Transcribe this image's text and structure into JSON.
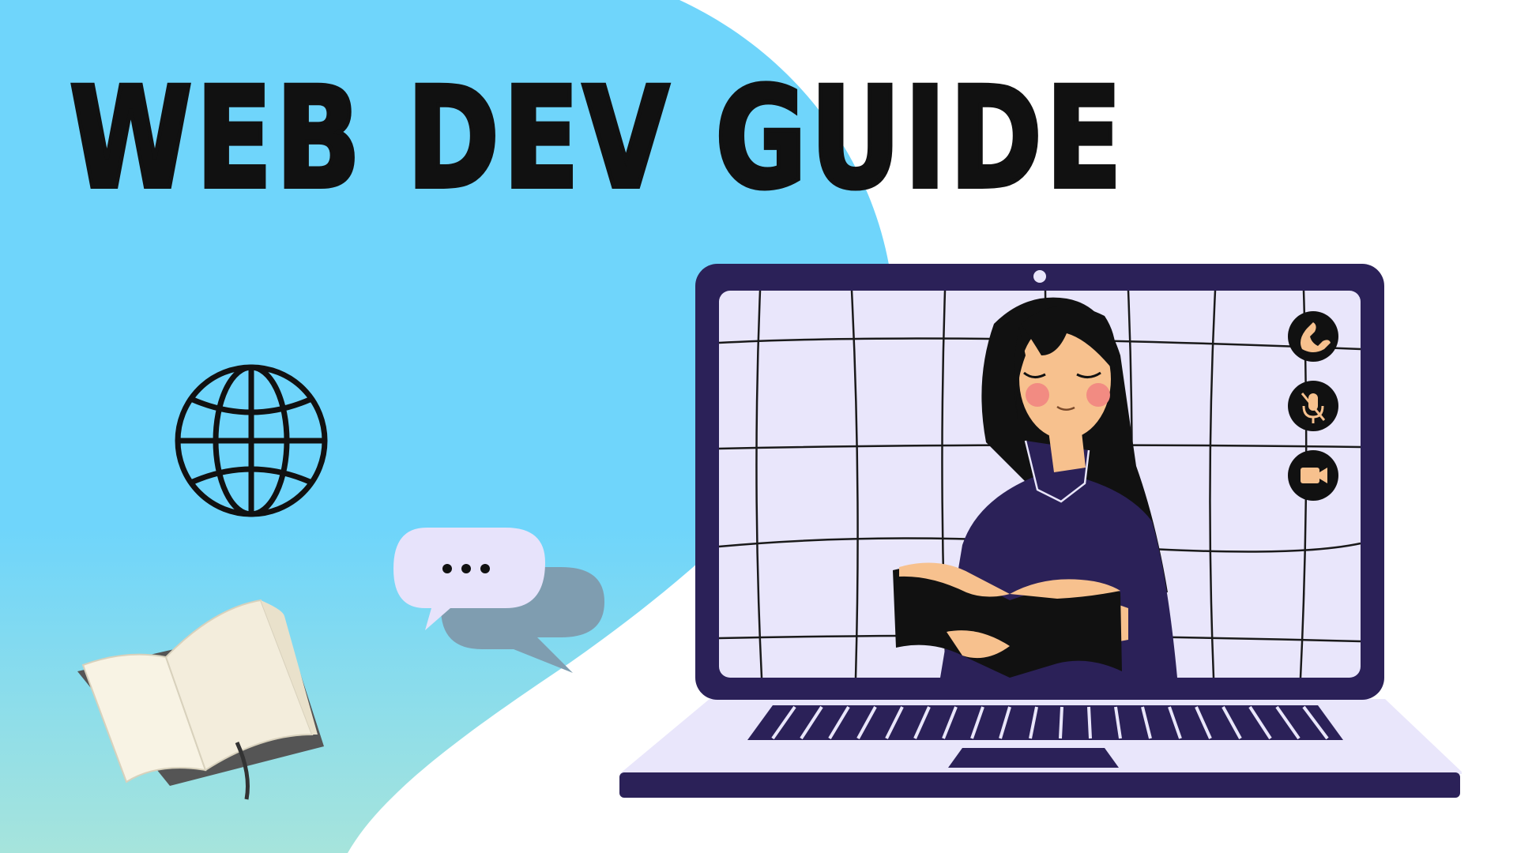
{
  "title": "WEB DEV GUIDE",
  "colors": {
    "background": "#ffffff",
    "blob_top": "#6fd5fb",
    "blob_bottom": "#a6e4dc",
    "title_text": "#111111",
    "laptop_frame": "#2b2158",
    "screen_bg": "#e9e6fb",
    "skin": "#f7c18e",
    "cheek": "#f28b82",
    "hair": "#111111",
    "sweater": "#2b2158",
    "bubble_front": "#e7e3fb",
    "bubble_back": "#7f9db0"
  },
  "icons": {
    "globe": "globe-icon",
    "book": "open-book-icon",
    "chat": "chat-bubble-icon",
    "typing": "typing-dots-icon",
    "laptop": "laptop-icon",
    "webcam": "webcam-icon",
    "call": "phone-call-icon",
    "mute": "microphone-muted-icon",
    "video": "video-camera-icon"
  }
}
